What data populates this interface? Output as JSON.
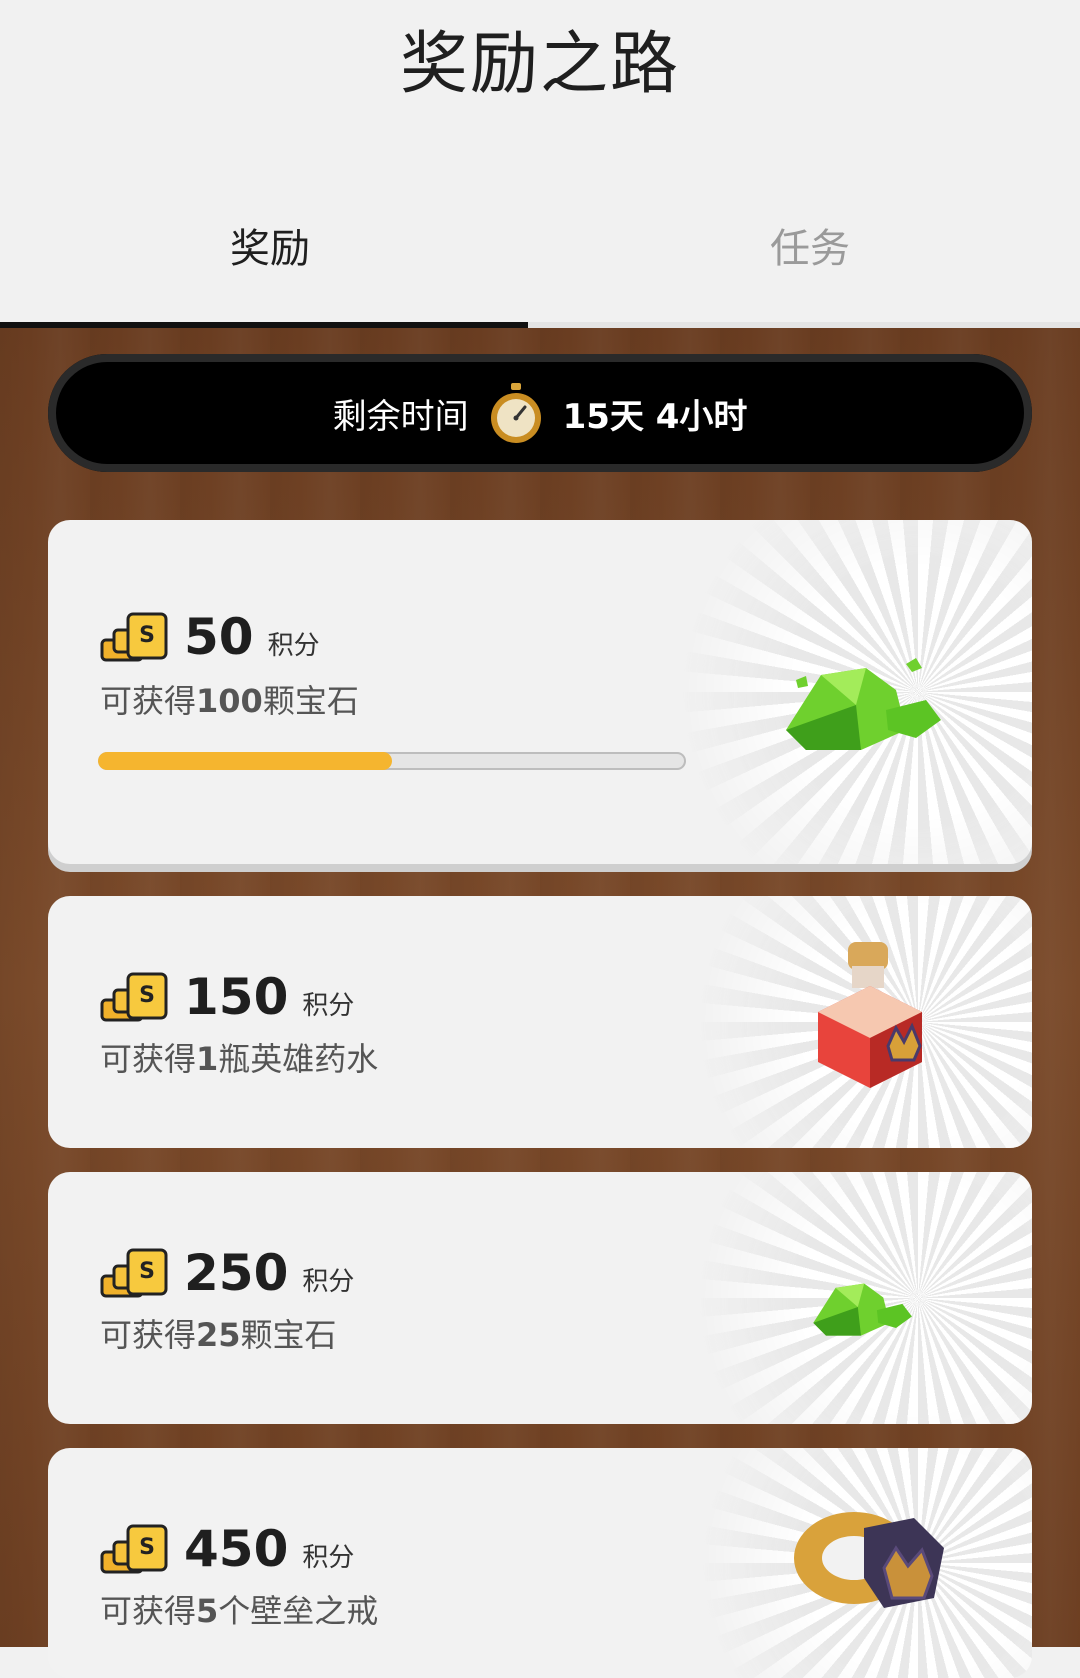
{
  "header": {
    "title": "奖励之路"
  },
  "tabs": [
    {
      "label": "奖励"
    },
    {
      "label": "任务"
    }
  ],
  "timer": {
    "label": "剩余时间",
    "value": "15天 4小时",
    "icon": "stopwatch-icon"
  },
  "rewards": [
    {
      "points": "50",
      "unit": "积分",
      "desc_prefix": "可获得",
      "desc_bold": "100",
      "desc_suffix": "颗宝石",
      "icon": "gems-icon",
      "progress": 0.5
    },
    {
      "points": "150",
      "unit": "积分",
      "desc_prefix": "可获得",
      "desc_bold": "1",
      "desc_suffix": "瓶英雄药水",
      "icon": "hero-potion-icon"
    },
    {
      "points": "250",
      "unit": "积分",
      "desc_prefix": "可获得",
      "desc_bold": "25",
      "desc_suffix": "颗宝石",
      "icon": "gems-small-icon"
    },
    {
      "points": "450",
      "unit": "积分",
      "desc_prefix": "可获得",
      "desc_bold": "5",
      "desc_suffix": "个壁垒之戒",
      "icon": "wall-ring-icon"
    }
  ],
  "colors": {
    "progress_fill": "#f5b52f",
    "wood": "#7a4a2a",
    "accent": "#111111"
  }
}
